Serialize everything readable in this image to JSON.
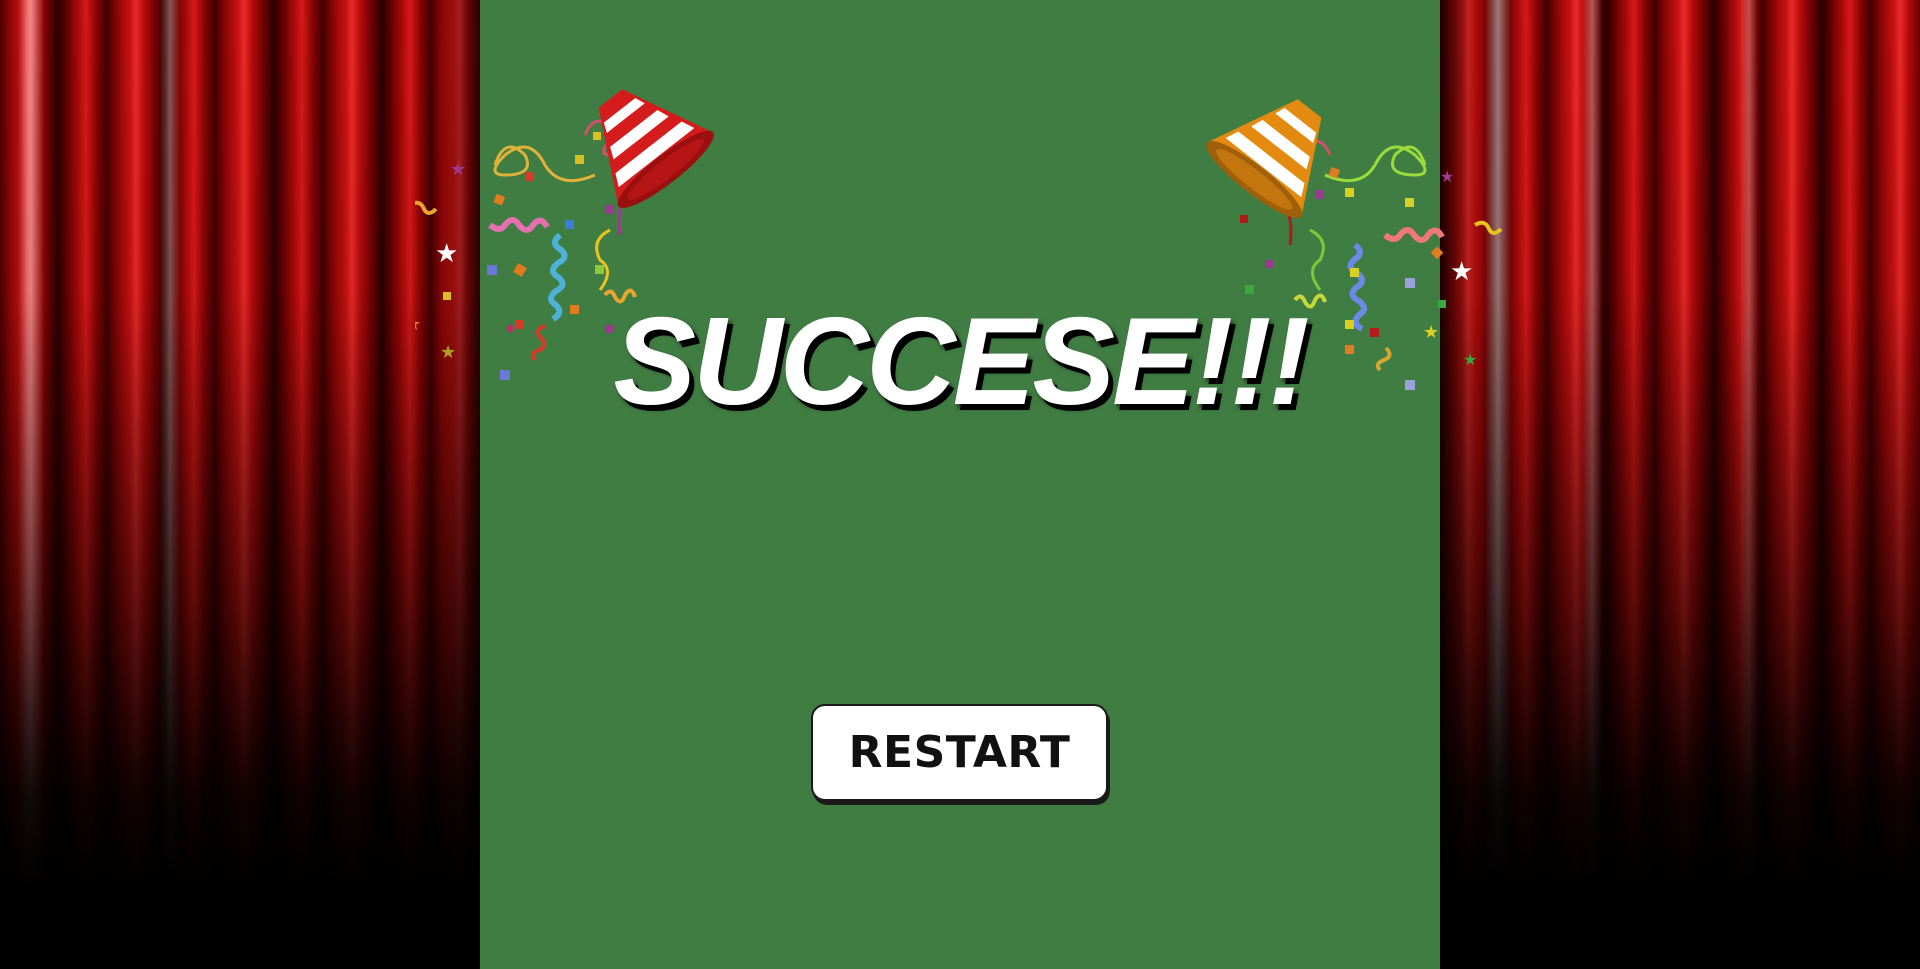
{
  "screen": {
    "title": "SUCCESE!!!",
    "restart_label": "RESTART"
  },
  "colors": {
    "panel_background": "#407d42",
    "curtain_red": "#c71212",
    "title_text": "#ffffff",
    "button_background": "#ffffff",
    "button_text": "#111111"
  },
  "decorations": {
    "left_popper": "red-striped-party-popper",
    "right_popper": "orange-striped-party-popper",
    "confetti": "confetti-and-streamers"
  }
}
